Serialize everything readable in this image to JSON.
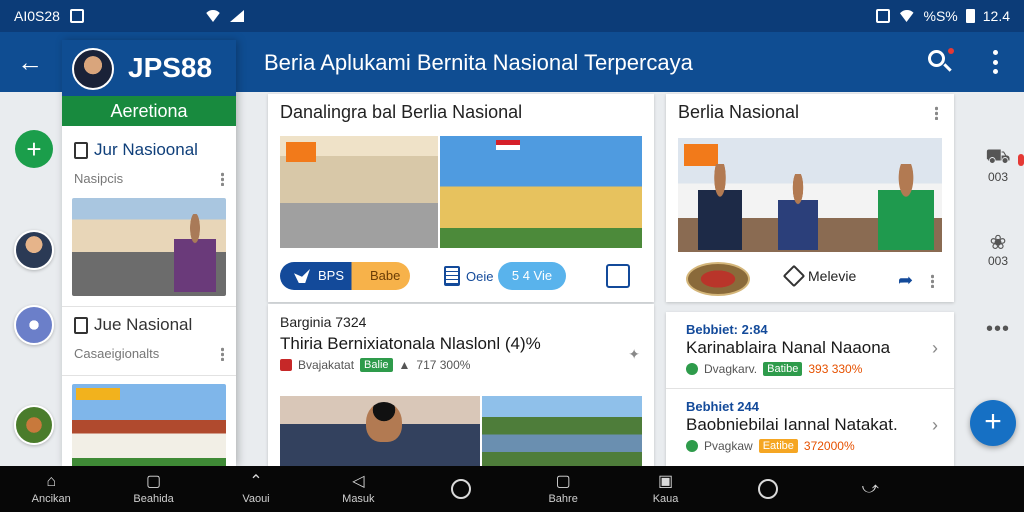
{
  "status_bar": {
    "left_text": "AI0S28",
    "time": "12.4",
    "battery_text": "%S%"
  },
  "app_bar": {
    "title": "Beria Aplukami Bernita Nasional Terpercaya",
    "back_icon": "arrow-left-icon",
    "search_icon": "search-icon",
    "more_icon": "more-vert-icon"
  },
  "drawer": {
    "brand": "JPS88",
    "tab_label": "Aeretiona",
    "section1": {
      "label": "Jur Nasioonal",
      "sub": "Nasipcis"
    },
    "section2": {
      "label": "Jue Nasional",
      "sub": "Casaeigionalts"
    }
  },
  "center": {
    "card_a": {
      "title": "Danalingra bal Berlia Nasional",
      "pill_left": "BPS",
      "pill_right": "Babe",
      "doc_label": "Oeie",
      "pill_light": "5 4 Vie"
    },
    "card_b": {
      "kicker": "Barginia 7324",
      "headline": "Thiria Bernixiatonala Nlaslonl (4)%",
      "author": "Bvajakatat",
      "chip": "Balie",
      "stat": "717 300%"
    }
  },
  "right": {
    "card_c": {
      "title": "Berlia Nasional",
      "fav_label": "Melevie"
    },
    "news": [
      {
        "kicker": "Bebbiet: 2:84",
        "headline": "Karinablaira Nanal Naaona",
        "author": "Dvagkarv.",
        "chip": "Batibe",
        "stat": "393 330%"
      },
      {
        "kicker": "Bebhiet 244",
        "headline": "Baobniebilai Iannal Natakat.",
        "author": "Pvagkaw",
        "chip": "Eatibe",
        "stat": "372000%"
      }
    ]
  },
  "right_rail": [
    {
      "icon": "car-icon",
      "count": "003"
    },
    {
      "icon": "paw-icon",
      "count": "003"
    }
  ],
  "bottom_nav": [
    {
      "icon": "home-icon",
      "label": "Ancikan"
    },
    {
      "icon": "square-icon",
      "label": "Beahida"
    },
    {
      "icon": "caret-up-icon",
      "label": "Vaoui"
    },
    {
      "icon": "triangle-left-icon",
      "label": "Masuk"
    },
    {
      "icon": "circle-icon",
      "label": ""
    },
    {
      "icon": "square-icon",
      "label": "Bahre"
    },
    {
      "icon": "bag-icon",
      "label": "Kaua"
    },
    {
      "icon": "circle-icon",
      "label": ""
    },
    {
      "icon": "share-icon",
      "label": ""
    }
  ],
  "colors": {
    "primary": "#0f4d92",
    "status_bar": "#0c3c78",
    "accent_green": "#188a3e",
    "fab": "#1670c4"
  }
}
